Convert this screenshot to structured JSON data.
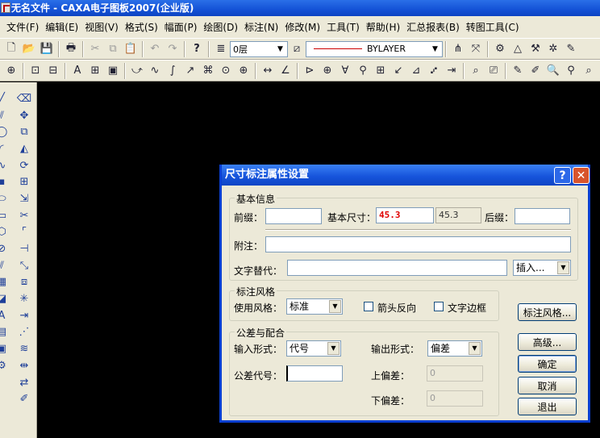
{
  "window": {
    "title": "无名文件 - CAXA电子图板2007(企业版)"
  },
  "menu": [
    "文件(F)",
    "编辑(E)",
    "视图(V)",
    "格式(S)",
    "幅面(P)",
    "绘图(D)",
    "标注(N)",
    "修改(M)",
    "工具(T)",
    "帮助(H)",
    "汇总报表(B)",
    "转图工具(C)"
  ],
  "toolbar": {
    "layer_value": "0层",
    "linetype_value": "BYLAYER"
  },
  "dialog": {
    "title": "尺寸标注属性设置",
    "basic_group": "基本信息",
    "prefix_label": "前缀：",
    "prefix_value": "",
    "base_size_label": "基本尺寸：",
    "base_size_value": "45.3",
    "base_size_readonly": "45.3",
    "suffix_label": "后缀：",
    "suffix_value": "",
    "note_label": "附注：",
    "note_value": "",
    "text_replace_label": "文字替代：",
    "text_replace_value": "",
    "insert_value": "插入...",
    "style_group": "标注风格",
    "use_style_label": "使用风格：",
    "use_style_value": "标准",
    "arrow_reverse_label": "箭头反向",
    "text_frame_label": "文字边框",
    "style_button": "标注风格...",
    "tolerance_group": "公差与配合",
    "input_form_label": "输入形式：",
    "input_form_value": "代号",
    "output_form_label": "输出形式：",
    "output_form_value": "偏差",
    "tolerance_code_label": "公差代号：",
    "tolerance_code_value": "",
    "upper_dev_label": "上偏差：",
    "upper_dev_value": "0",
    "lower_dev_label": "下偏差：",
    "lower_dev_value": "0",
    "advanced_button": "高级...",
    "ok_button": "确定",
    "cancel_button": "取消",
    "exit_button": "退出"
  }
}
